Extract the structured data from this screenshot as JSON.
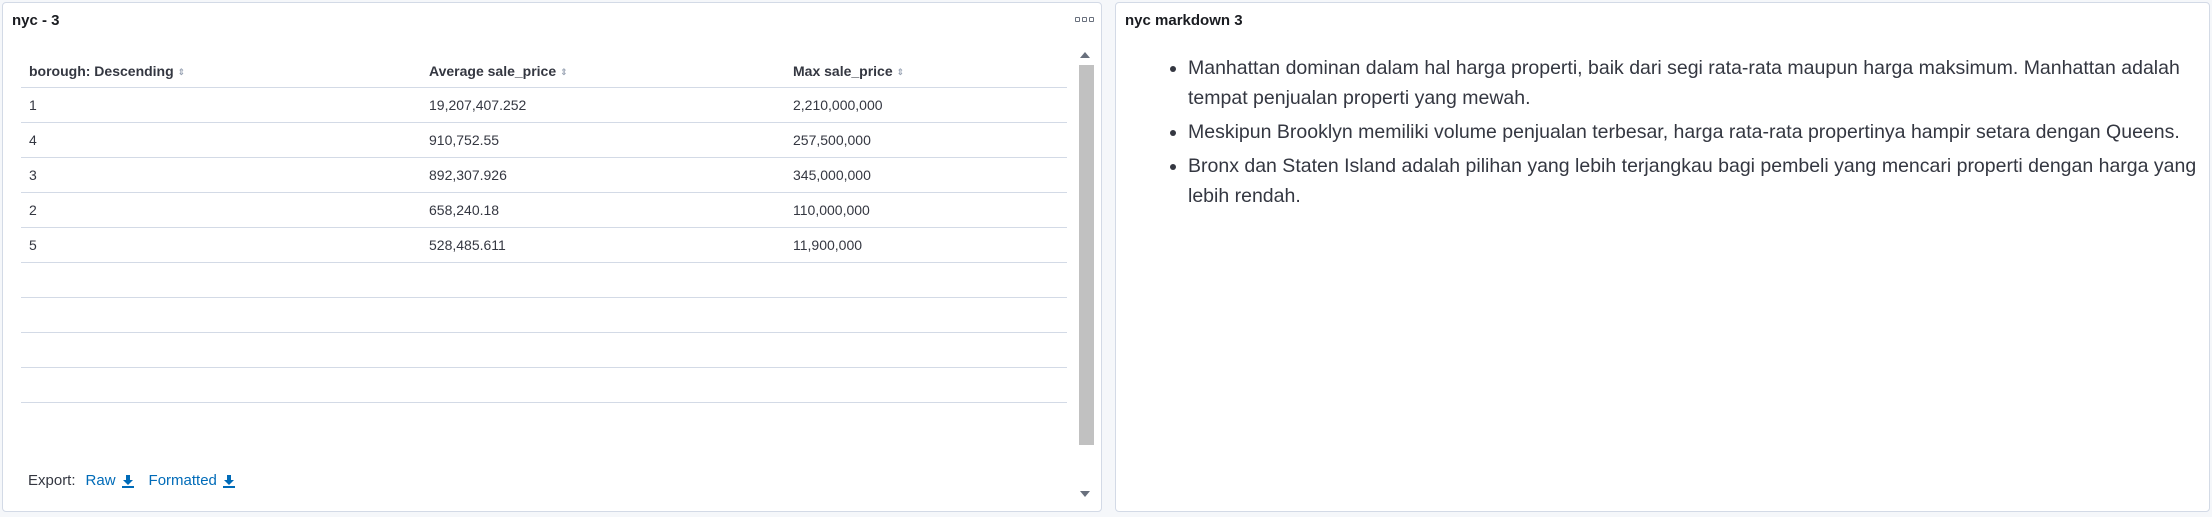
{
  "left_panel": {
    "title": "nyc - 3",
    "table": {
      "headers": [
        "borough: Descending",
        "Average sale_price",
        "Max sale_price"
      ],
      "rows": [
        [
          "1",
          "19,207,407.252",
          "2,210,000,000"
        ],
        [
          "4",
          "910,752.55",
          "257,500,000"
        ],
        [
          "3",
          "892,307.926",
          "345,000,000"
        ],
        [
          "2",
          "658,240.18",
          "110,000,000"
        ],
        [
          "5",
          "528,485.611",
          "11,900,000"
        ]
      ]
    },
    "export": {
      "label": "Export:",
      "raw_label": "Raw",
      "formatted_label": "Formatted"
    }
  },
  "right_panel": {
    "title": "nyc markdown 3",
    "bullets": [
      "Manhattan dominan dalam hal harga properti, baik dari segi rata-rata maupun harga maksimum. Manhattan adalah tempat penjualan properti yang mewah.",
      "Meskipun Brooklyn memiliki volume penjualan terbesar, harga rata-rata propertinya hampir setara dengan Queens.",
      "Bronx dan Staten Island adalah pilihan yang lebih terjangkau bagi pembeli yang mencari properti dengan harga yang lebih rendah."
    ]
  },
  "icons": {
    "sort": "sort-icon",
    "download": "download-icon",
    "panel_options": "panel-options-icon"
  },
  "colors": {
    "link": "#006bb8",
    "border": "#d3dae6",
    "text": "#343741"
  }
}
